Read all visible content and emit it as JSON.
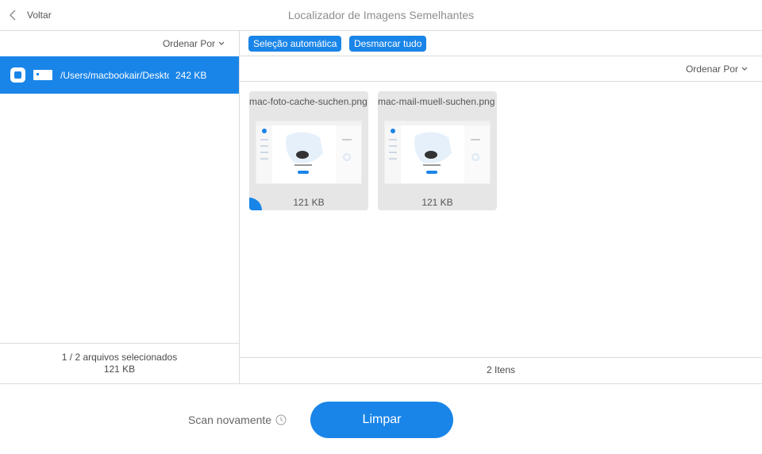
{
  "header": {
    "back_label": "Voltar",
    "title": "Localizador de Imagens Semelhantes"
  },
  "left": {
    "sort_label": "Ordenar Por",
    "folder": {
      "path": "/Users/macbookair/Desktop",
      "size": "242 KB"
    },
    "footer": {
      "selected": "1 / 2 arquivos selecionados",
      "size": "121 KB"
    }
  },
  "right": {
    "auto_select_label": "Seleção automática",
    "unmark_all_label": "Desmarcar tudo",
    "sort_label": "Ordenar Por",
    "images": [
      {
        "name": "mac-foto-cache-suchen.png",
        "size": "121 KB",
        "selected": true
      },
      {
        "name": "mac-mail-muell-suchen.png",
        "size": "121 KB",
        "selected": false
      }
    ],
    "footer_count": "2 Itens"
  },
  "bottom": {
    "rescan_label": "Scan novamente",
    "clean_label": "Limpar"
  },
  "colors": {
    "accent": "#1a85e8",
    "divider": "#dcdcdc",
    "card_bg": "#e6e6e6"
  },
  "icons": [
    "chevron-left-icon",
    "chevron-down-icon",
    "folder-icon",
    "clock-icon"
  ]
}
